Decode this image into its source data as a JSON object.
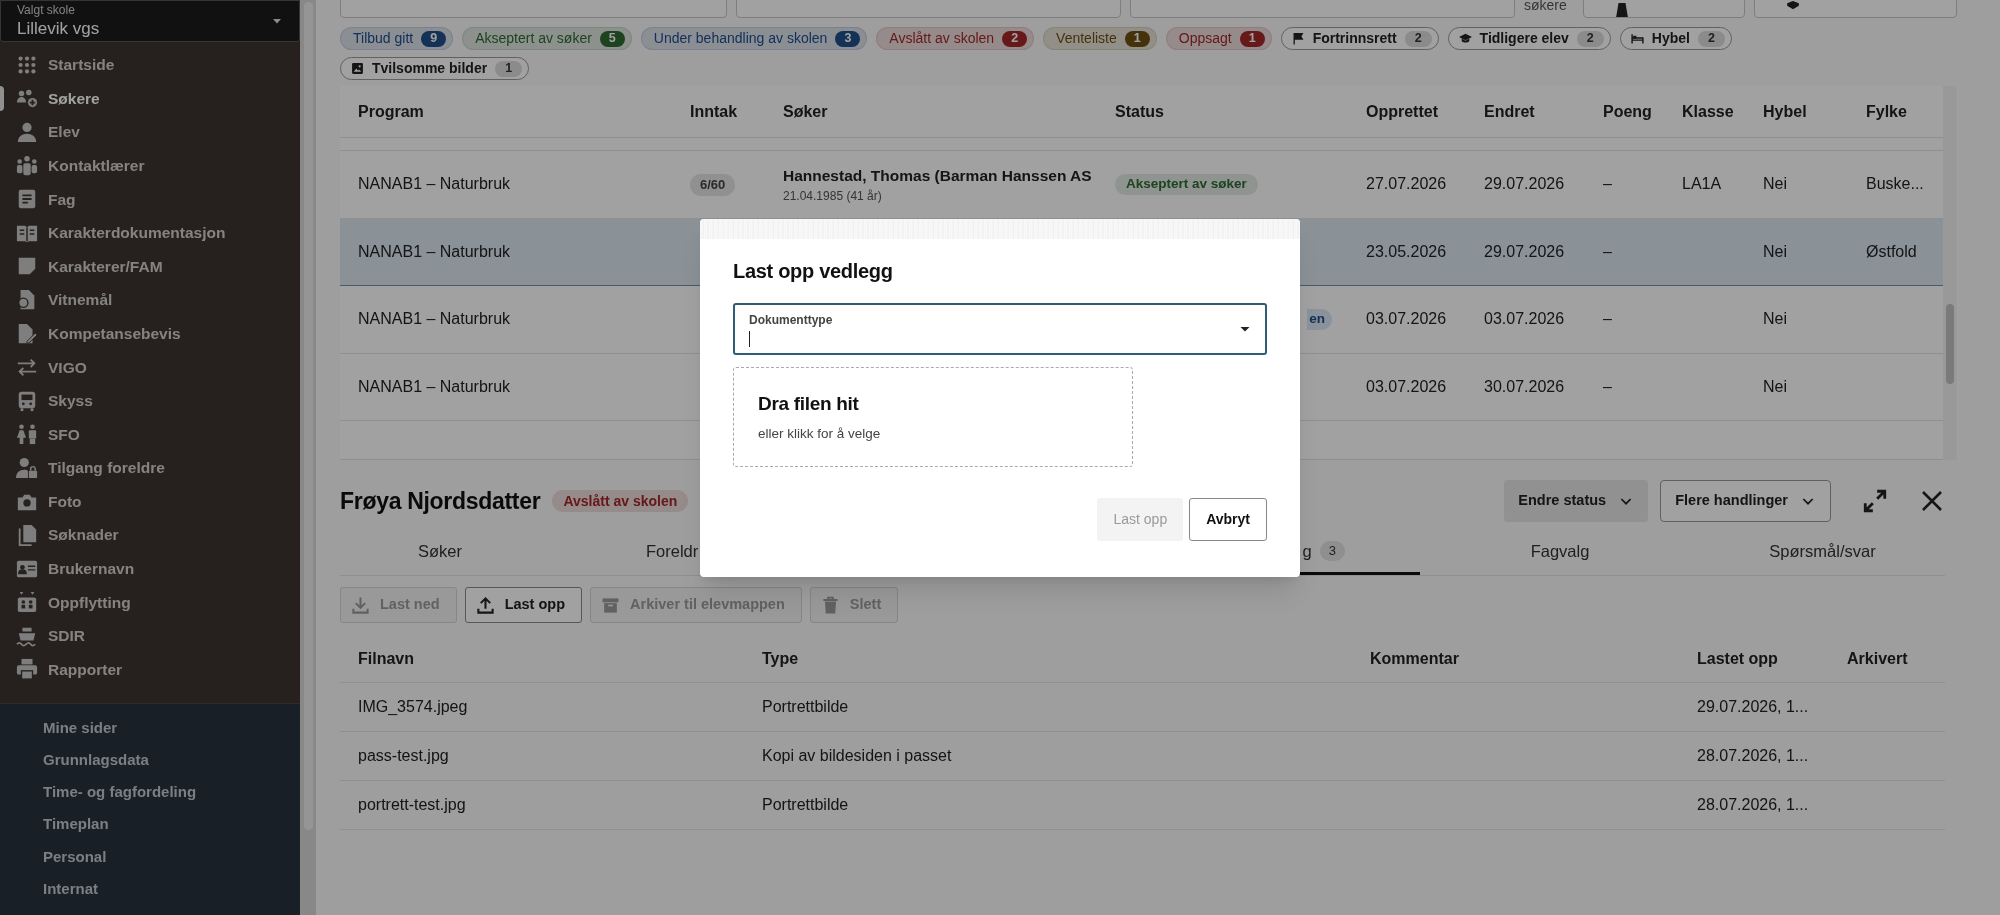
{
  "sidebar": {
    "school_label": "Valgt skole",
    "school": "Lillevik vgs",
    "items": [
      {
        "label": "Startside",
        "selected": false
      },
      {
        "label": "Søkere",
        "selected": true
      },
      {
        "label": "Elev",
        "selected": false
      },
      {
        "label": "Kontaktlærer",
        "selected": false
      },
      {
        "label": "Fag",
        "selected": false
      },
      {
        "label": "Karakterdokumentasjon",
        "selected": false
      },
      {
        "label": "Karakterer/FAM",
        "selected": false
      },
      {
        "label": "Vitnemål",
        "selected": false
      },
      {
        "label": "Kompetansebevis",
        "selected": false
      },
      {
        "label": "VIGO",
        "selected": false
      },
      {
        "label": "Skyss",
        "selected": false
      },
      {
        "label": "SFO",
        "selected": false
      },
      {
        "label": "Tilgang foreldre",
        "selected": false
      },
      {
        "label": "Foto",
        "selected": false
      },
      {
        "label": "Søknader",
        "selected": false
      },
      {
        "label": "Brukernavn",
        "selected": false
      },
      {
        "label": "Oppflytting",
        "selected": false
      },
      {
        "label": "SDIR",
        "selected": false
      },
      {
        "label": "Rapporter",
        "selected": false
      }
    ],
    "secondary_items": [
      "Mine sider",
      "Grunnlagsdata",
      "Time- og fagfordeling",
      "Timeplan",
      "Personal",
      "Internat"
    ]
  },
  "filters": {
    "note": "søkere"
  },
  "chips": [
    {
      "kind": "status",
      "label": "Tilbud gitt",
      "count": "9",
      "color": "#143158"
    },
    {
      "kind": "status",
      "label": "Akseptert av søker",
      "count": "5",
      "color": "#1d4321"
    },
    {
      "kind": "status",
      "label": "Under behandling av skolen",
      "count": "3",
      "color": "#143158"
    },
    {
      "kind": "status",
      "label": "Avslått av skolen",
      "count": "2",
      "color": "#671919"
    },
    {
      "kind": "status",
      "label": "Venteliste",
      "count": "1",
      "color": "#45320a"
    },
    {
      "kind": "status",
      "label": "Oppsagt",
      "count": "1",
      "color": "#671919"
    },
    {
      "kind": "filter",
      "label": "Fortrinnsrett",
      "count": "2"
    },
    {
      "kind": "filter",
      "label": "Tidligere elev",
      "count": "2"
    },
    {
      "kind": "filter",
      "label": "Hybel",
      "count": "2"
    },
    {
      "kind": "filter",
      "label": "Tvilsomme bilder",
      "count": "1"
    }
  ],
  "table": {
    "columns": [
      "Program",
      "Inntak",
      "Søker",
      "Status",
      "Opprettet",
      "Endret",
      "Poeng",
      "Klasse",
      "Hybel",
      "Fylke"
    ],
    "rows": [
      {
        "selected": false,
        "program": "NANAB1 – Naturbruk",
        "intake": "6/60",
        "applicant": "Hannestad, Thomas (Barman Hanssen AS",
        "born": "21.04.1985 (41 år)",
        "status": {
          "label": "Akseptert av søker"
        },
        "created": "27.07.2026",
        "changed": "29.07.2026",
        "points": "–",
        "class": "LA1A",
        "hybel": "Nei",
        "county": "Buske..."
      },
      {
        "selected": true,
        "program": "NANAB1 – Naturbruk",
        "created": "23.05.2026",
        "changed": "29.07.2026",
        "points": "–",
        "hybel": "Nei",
        "county": "Østfold"
      },
      {
        "selected": false,
        "program": "NANAB1 – Naturbruk",
        "status_tail": "en",
        "created": "03.07.2026",
        "changed": "03.07.2026",
        "points": "–",
        "hybel": "Nei"
      },
      {
        "selected": false,
        "program": "NANAB1 – Naturbruk",
        "created": "03.07.2026",
        "changed": "30.07.2026",
        "points": "–",
        "hybel": "Nei"
      }
    ]
  },
  "detail": {
    "name": "Frøya Njordsdatter",
    "status": {
      "label": "Avslått av skolen"
    },
    "actions": [
      "Endre status",
      "Flere handlinger"
    ],
    "tabs": [
      {
        "label": "Søker",
        "selected": false
      },
      {
        "label": "Foreldr",
        "selected": false
      },
      {
        "label": "g",
        "count": "3",
        "selected": true
      },
      {
        "label": "Fagvalg",
        "selected": false
      },
      {
        "label": "Spørsmål/svar",
        "selected": false
      }
    ],
    "toolbar": [
      {
        "label": "Last ned",
        "disabled": true
      },
      {
        "label": "Last opp",
        "disabled": false
      },
      {
        "label": "Arkiver til elevmappen",
        "disabled": true
      },
      {
        "label": "Slett",
        "disabled": true
      }
    ],
    "files": {
      "columns": [
        "Filnavn",
        "Type",
        "Kommentar",
        "Lastet opp",
        "Arkivert"
      ],
      "rows": [
        [
          "IMG_3574.jpeg",
          "Portrettbilde",
          "",
          "29.07.2026, 1...",
          ""
        ],
        [
          "pass-test.jpg",
          "Kopi av bildesiden i passet",
          "",
          "28.07.2026, 1...",
          ""
        ],
        [
          "portrett-test.jpg",
          "Portrettbilde",
          "",
          "28.07.2026, 1...",
          ""
        ]
      ]
    }
  },
  "modal": {
    "title": "Last opp vedlegg",
    "field_label": "Dokumenttype",
    "drop_title": "Dra filen hit",
    "drop_hint": "eller klikk for å velge",
    "buttons": [
      {
        "label": "Last opp",
        "disabled": true
      },
      {
        "label": "Avbryt",
        "disabled": false
      }
    ]
  }
}
